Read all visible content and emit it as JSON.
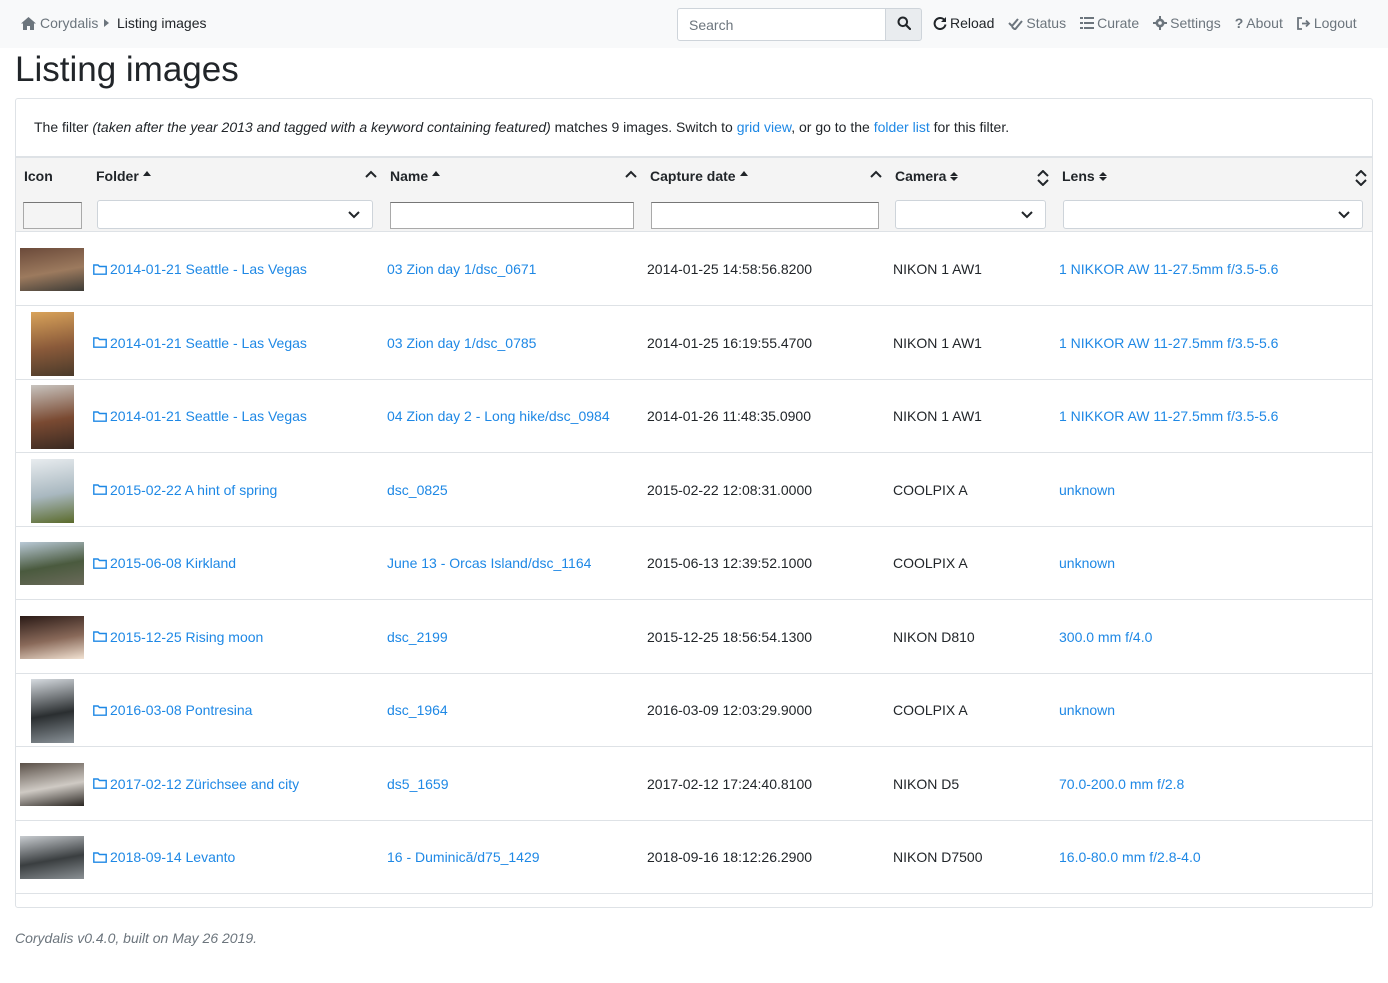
{
  "nav": {
    "brand": "Corydalis",
    "current": "Listing images",
    "search_placeholder": "Search",
    "links": [
      {
        "label": "Reload",
        "icon": "refresh-icon"
      },
      {
        "label": "Status",
        "icon": "check-double-icon"
      },
      {
        "label": "Curate",
        "icon": "list-icon"
      },
      {
        "label": "Settings",
        "icon": "gear-icon"
      },
      {
        "label": "About",
        "icon": "question-icon"
      },
      {
        "label": "Logout",
        "icon": "sign-out-icon"
      }
    ]
  },
  "page": {
    "title": "Listing images",
    "filter_prefix": "The filter ",
    "filter_expr": "(taken after the year 2013 and tagged with a keyword containing featured)",
    "filter_mid": " matches 9 images. Switch to ",
    "grid_link": "grid view",
    "filter_mid2": ", or go to the ",
    "folder_link": "folder list",
    "filter_suffix": " for this filter."
  },
  "table": {
    "headers": {
      "icon": "Icon",
      "folder": "Folder",
      "name": "Name",
      "capture": "Capture date",
      "camera": "Camera",
      "lens": "Lens"
    },
    "rows": [
      {
        "folder": "2014-01-21 Seattle - Las Vegas",
        "name": "03 Zion day 1/dsc_0671",
        "date": "2014-01-25 14:58:56.8200",
        "camera": "NIKON 1 AW1",
        "lens": "1 NIKKOR AW 11-27.5mm f/3.5-5.6",
        "thumb": "landscape",
        "colors": [
          "#6b4a3a",
          "#9c7a5e",
          "#3d3b36"
        ]
      },
      {
        "folder": "2014-01-21 Seattle - Las Vegas",
        "name": "03 Zion day 1/dsc_0785",
        "date": "2014-01-25 16:19:55.4700",
        "camera": "NIKON 1 AW1",
        "lens": "1 NIKKOR AW 11-27.5mm f/3.5-5.6",
        "thumb": "portrait",
        "colors": [
          "#d9a35a",
          "#8a5a3a",
          "#4a3a2a"
        ]
      },
      {
        "folder": "2014-01-21 Seattle - Las Vegas",
        "name": "04 Zion day 2 - Long hike/dsc_0984",
        "date": "2014-01-26 11:48:35.0900",
        "camera": "NIKON 1 AW1",
        "lens": "1 NIKKOR AW 11-27.5mm f/3.5-5.6",
        "thumb": "portrait",
        "colors": [
          "#c8c4bf",
          "#7a4a32",
          "#3a2a22"
        ]
      },
      {
        "folder": "2015-02-22 A hint of spring",
        "name": "dsc_0825",
        "date": "2015-02-22 12:08:31.0000",
        "camera": "COOLPIX A",
        "lens": "unknown",
        "thumb": "portrait",
        "colors": [
          "#e8ecef",
          "#a9b8c0",
          "#5a6a2a"
        ]
      },
      {
        "folder": "2015-06-08 Kirkland",
        "name": "June 13 - Orcas Island/dsc_1164",
        "date": "2015-06-13 12:39:52.1000",
        "camera": "COOLPIX A",
        "lens": "unknown",
        "thumb": "wide",
        "colors": [
          "#b9c9d6",
          "#4a5a3e",
          "#6a6a5a"
        ]
      },
      {
        "folder": "2015-12-25 Rising moon",
        "name": "dsc_2199",
        "date": "2015-12-25 18:56:54.1300",
        "camera": "NIKON D810",
        "lens": "300.0 mm f/4.0",
        "thumb": "landscape",
        "colors": [
          "#2a1a16",
          "#8a6a5a",
          "#f2e2d2"
        ]
      },
      {
        "folder": "2016-03-08 Pontresina",
        "name": "dsc_1964",
        "date": "2016-03-09 12:03:29.9000",
        "camera": "COOLPIX A",
        "lens": "unknown",
        "thumb": "portrait",
        "colors": [
          "#d6dbe0",
          "#2a2e30",
          "#8a9298"
        ]
      },
      {
        "folder": "2017-02-12 Zürichsee and city",
        "name": "ds5_1659",
        "date": "2017-02-12 17:24:40.8100",
        "camera": "NIKON D5",
        "lens": "70.0-200.0 mm f/2.8",
        "thumb": "landscape",
        "colors": [
          "#5a5048",
          "#cfcac4",
          "#2a2622"
        ]
      },
      {
        "folder": "2018-09-14 Levanto",
        "name": "16 - Duminică/d75_1429",
        "date": "2018-09-16 18:12:26.2900",
        "camera": "NIKON D7500",
        "lens": "16.0-80.0 mm f/2.8-4.0",
        "thumb": "wide",
        "colors": [
          "#c8ccd0",
          "#3a3e40",
          "#8a9094"
        ]
      }
    ]
  },
  "footer": "Corydalis v0.4.0, built on May 26 2019.",
  "colors": {
    "link": "#1e88e5",
    "muted": "#6c757d",
    "text": "#212529"
  }
}
